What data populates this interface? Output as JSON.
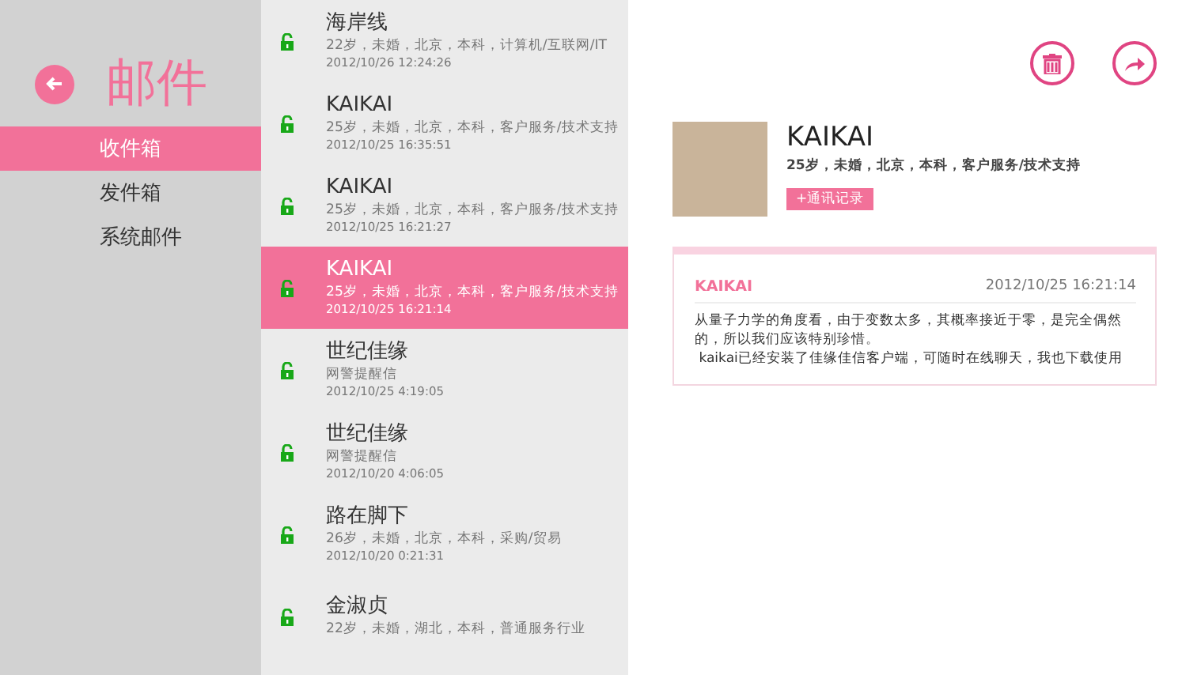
{
  "sidebar": {
    "title": "邮件",
    "folders": [
      {
        "label": "收件箱",
        "selected": true
      },
      {
        "label": "发件箱",
        "selected": false
      },
      {
        "label": "系统邮件",
        "selected": false
      }
    ]
  },
  "messages": [
    {
      "name": "海岸线",
      "detail": "22岁，未婚，北京，本科，计算机/互联网/IT",
      "time": "2012/10/26 12:24:26",
      "selected": false
    },
    {
      "name": "KAIKAI",
      "detail": "25岁，未婚，北京，本科，客户服务/技术支持",
      "time": "2012/10/25 16:35:51",
      "selected": false
    },
    {
      "name": "KAIKAI",
      "detail": "25岁，未婚，北京，本科，客户服务/技术支持",
      "time": "2012/10/25 16:21:27",
      "selected": false
    },
    {
      "name": "KAIKAI",
      "detail": "25岁，未婚，北京，本科，客户服务/技术支持",
      "time": "2012/10/25   16:21:14",
      "selected": true
    },
    {
      "name": "世纪佳缘",
      "detail": "网警提醒信",
      "time": "2012/10/25 4:19:05",
      "selected": false
    },
    {
      "name": "世纪佳缘",
      "detail": "网警提醒信",
      "time": "2012/10/20 4:06:05",
      "selected": false
    },
    {
      "name": "路在脚下",
      "detail": "26岁，未婚，北京，本科，采购/贸易",
      "time": "2012/10/20 0:21:31",
      "selected": false
    },
    {
      "name": "金淑贞",
      "detail": "22岁，未婚，湖北，本科，普通服务行业",
      "selected": false
    }
  ],
  "detail": {
    "name": "KAIKAI",
    "info": "25岁，未婚，北京，本科，客户服务/技术支持",
    "history_button": "+通讯记录",
    "message": {
      "sender": "KAIKAI",
      "time": "2012/10/25 16:21:14",
      "body": [
        "从量子力学的角度看，由于变数太多，其概率接近于零，是完全偶然的，所以我们应该特别珍惜。",
        " kaikai已经安装了佳缘佳信客户端，可随时在线聊天，我也下载使用"
      ]
    }
  }
}
